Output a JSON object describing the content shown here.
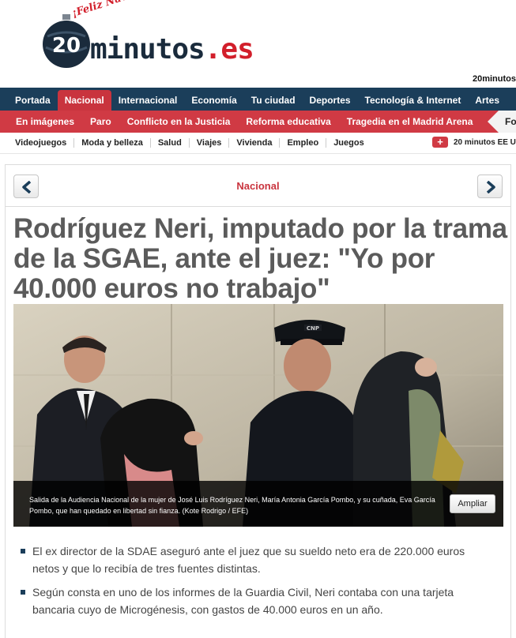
{
  "header": {
    "brand_main": "minutos",
    "brand_suffix": ".es",
    "brand_number": "20",
    "greeting": "¡Feliz Navidad!",
    "site_link": "20minutos"
  },
  "nav_main": {
    "items": [
      {
        "label": "Portada"
      },
      {
        "label": "Nacional",
        "active": true
      },
      {
        "label": "Internacional"
      },
      {
        "label": "Economía"
      },
      {
        "label": "Tu ciudad"
      },
      {
        "label": "Deportes"
      },
      {
        "label": "Tecnología & Internet"
      },
      {
        "label": "Artes"
      }
    ]
  },
  "nav_sub": {
    "items": [
      {
        "label": "En imágenes"
      },
      {
        "label": "Paro"
      },
      {
        "label": "Conflicto en la Justicia"
      },
      {
        "label": "Reforma educativa"
      },
      {
        "label": "Tragedia en el Madrid Arena"
      }
    ],
    "overflow_label": "Fo"
  },
  "nav_third": {
    "items": [
      {
        "label": "Videojuegos"
      },
      {
        "label": "Moda y belleza"
      },
      {
        "label": "Salud"
      },
      {
        "label": "Viajes"
      },
      {
        "label": "Vivienda"
      },
      {
        "label": "Empleo"
      },
      {
        "label": "Juegos"
      }
    ],
    "promo_label": "20 minutos EE U"
  },
  "article": {
    "section": "Nacional",
    "headline": "Rodríguez Neri, imputado por la trama de la SGAE, ante el juez: \"Yo por 40.000 euros no trabajo\"",
    "photo_caption": "Salida de la Audiencia Nacional de la mujer de José Luis Rodríguez Neri, María Antonia García Pombo, y su cuñada, Eva García Pombo, que han quedado en libertad sin fianza. (Kote Rodrigo / EFE)",
    "ampliar_label": "Ampliar",
    "officer_badge": "CNP",
    "bullets": [
      "El ex director de la SDAE aseguró ante el juez que su sueldo neto era de 220.000 euros netos y que lo recibía de tres fuentes distintas.",
      "Según consta en uno de los informes de la Guardia Civil, Neri contaba con una tarjeta bancaria cuyo de Microgénesis, con gastos de 40.000 euros en un año."
    ]
  },
  "colors": {
    "nav_main_bg": "#1b3e5a",
    "nav_active_bg": "#c9343e",
    "nav_sub_bg": "#d03a44",
    "headline_color": "#5b5b5b"
  }
}
